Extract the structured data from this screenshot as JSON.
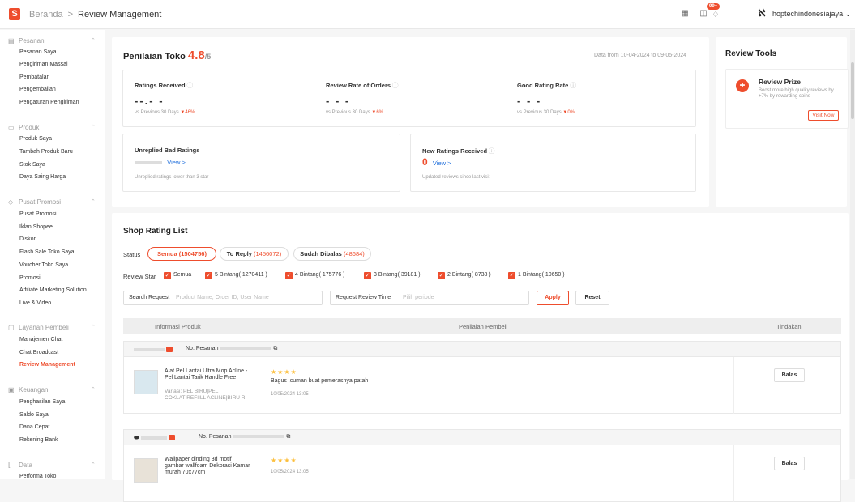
{
  "topbar": {
    "logo": "S",
    "crumb_home": "Beranda",
    "crumb_sep": ">",
    "crumb_current": "Review Management",
    "notif_badge": "99+",
    "username": "hoptechindonesiajaya",
    "icons": [
      "grid-icon",
      "book-icon",
      "bell-icon",
      "chevron-down-icon"
    ]
  },
  "sidebar": {
    "sections": [
      {
        "title": "Pesanan",
        "icon": "clipboard-icon",
        "items": [
          "Pesanan Saya",
          "Pengiriman Massal",
          "Pembatalan",
          "Pengembalian",
          "Pengaturan Pengiriman"
        ]
      },
      {
        "title": "Produk",
        "icon": "box-icon",
        "items": [
          "Produk Saya",
          "Tambah Produk Baru",
          "Stok Saya",
          "Daya Saing Harga"
        ]
      },
      {
        "title": "Pusat Promosi",
        "icon": "tag-icon",
        "items": [
          "Pusat Promosi",
          "Iklan Shopee",
          "Diskon",
          "Flash Sale Toko Saya",
          "Voucher Toko Saya",
          "Promosi",
          "Affiliate Marketing Solution",
          "Live & Video"
        ]
      },
      {
        "title": "Layanan Pembeli",
        "icon": "chat-icon",
        "items": [
          "Manajemen Chat",
          "Chat Broadcast",
          "Review Management"
        ]
      },
      {
        "title": "Keuangan",
        "icon": "wallet-icon",
        "items": [
          "Penghasilan Saya",
          "Saldo Saya",
          "Dana Cepat",
          "Rekening Bank"
        ]
      },
      {
        "title": "Data",
        "icon": "chart-icon",
        "items": [
          "Performa Toko"
        ]
      }
    ],
    "active_item": "Review Management"
  },
  "rating": {
    "title": "Penilaian Toko",
    "score": "4.8",
    "out_of": "/5",
    "date_range": "Data from 10-04-2024 to 09-05-2024",
    "metrics": [
      {
        "label": "Ratings Received",
        "value": "--.- -",
        "compare": "vs Previous 30 Days",
        "change": "▼46%"
      },
      {
        "label": "Review Rate of Orders",
        "value": "- - -",
        "compare": "vs Previous 30 Days",
        "change": "▼6%"
      },
      {
        "label": "Good Rating Rate",
        "value": "- - -",
        "compare": "vs Previous 30 Days",
        "change": "▼0%"
      }
    ],
    "unreplied": {
      "label": "Unreplied Bad Ratings",
      "link": "View >",
      "note": "Unreplied ratings lower than 3 star"
    },
    "new_ratings": {
      "label": "New Ratings Received",
      "value": "0",
      "link": "View >",
      "note": "Updated reviews since last visit"
    }
  },
  "tools": {
    "title": "Review Tools",
    "prize_title": "Review Prize",
    "prize_desc": "Boost more high quality reviews by +7% by rewarding coins",
    "visit_label": "Visit Now"
  },
  "list": {
    "title": "Shop Rating List",
    "status_label": "Status",
    "tabs": [
      {
        "label": "Semua",
        "count": "(1504756)"
      },
      {
        "label": "To Reply",
        "count": "(1456072)"
      },
      {
        "label": "Sudah Dibalas",
        "count": "(48684)"
      }
    ],
    "star_label": "Review Star",
    "stars": [
      "Semua",
      "5 Bintang( 1270411 )",
      "4 Bintang( 175776 )",
      "3 Bintang( 39181 )",
      "2 Bintang( 8738 )",
      "1 Bintang( 10650 )"
    ],
    "search_label": "Search Request",
    "search_placeholder": "Product Name, Order ID, User Name",
    "time_label": "Request Review Time",
    "time_placeholder": "Pilih periode",
    "apply_label": "Apply",
    "reset_label": "Reset",
    "columns": [
      "Informasi Produk",
      "Penilaian Pembeli",
      "Tindakan"
    ],
    "orders": [
      {
        "order_label": "No. Pesanan",
        "product": "Alat Pel Lantai Ultra Mop Acline - Pel Lantai Tarik Handle Free",
        "variant": "Variasi: PEL BIRU|PEL COKLAT|REFIILL ACLINE|BIRU R",
        "stars": "★★★★",
        "review": "Bagus ,cuman buat pemerasnya patah",
        "date": "10/05/2024 13:05",
        "action": "Balas"
      },
      {
        "order_label": "No. Pesanan",
        "product": "Wallpaper dinding 3d motif gambar wallfoam Dekorasi Kamar murah 70x77cm",
        "variant": "",
        "stars": "★★★★",
        "review": "",
        "date": "10/05/2024 13:05",
        "action": "Balas"
      }
    ]
  }
}
